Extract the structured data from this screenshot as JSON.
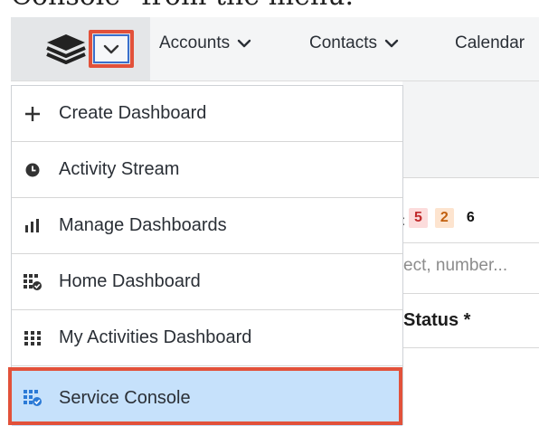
{
  "caption": "Console\" from the menu.",
  "nav": {
    "items": [
      {
        "label": "Accounts",
        "has_dropdown": true
      },
      {
        "label": "Contacts",
        "has_dropdown": true
      },
      {
        "label": "Calendar",
        "has_dropdown": false
      }
    ]
  },
  "background": {
    "badges": [
      "5",
      "2",
      "6"
    ],
    "search_placeholder": "ect, number...",
    "status_header": "Status *"
  },
  "menu": {
    "items": [
      {
        "label": "Create Dashboard",
        "icon": "plus-icon"
      },
      {
        "label": "Activity Stream",
        "icon": "clock-icon"
      },
      {
        "label": "Manage Dashboards",
        "icon": "bar-chart-icon"
      },
      {
        "label": "Home Dashboard",
        "icon": "dashboard-check-icon"
      },
      {
        "label": "My Activities Dashboard",
        "icon": "grid-icon"
      },
      {
        "label": "Service Console",
        "icon": "dashboard-check-icon",
        "selected": true
      }
    ]
  },
  "colors": {
    "highlight_border": "#e2513a",
    "selected_bg": "#c6e1fb",
    "accent_blue": "#2b7ad6"
  }
}
